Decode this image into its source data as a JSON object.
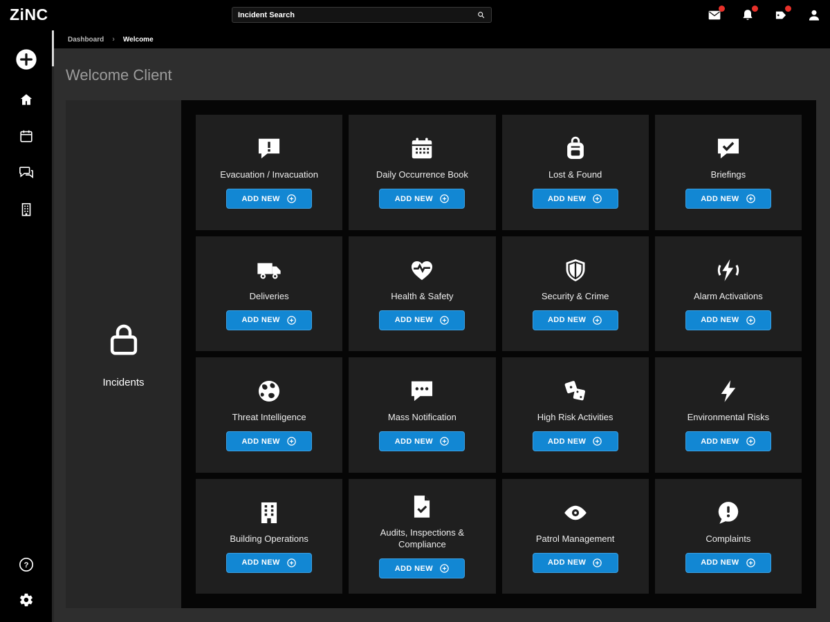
{
  "colors": {
    "accent_blue": "#1287d3",
    "badge_red": "#e8312a",
    "card_bg": "#1f1f1f",
    "panel_bg": "#060606",
    "main_bg": "#2e2e2e"
  },
  "topbar": {
    "logo": "ZiNC",
    "search": {
      "value": "Incident Search",
      "icon": "search-icon"
    },
    "actions": [
      {
        "name": "messages",
        "icon": "envelope-icon",
        "badge": true
      },
      {
        "name": "notifications",
        "icon": "bell-icon",
        "badge": true
      },
      {
        "name": "tickets",
        "icon": "ticket-icon",
        "badge": true
      },
      {
        "name": "profile",
        "icon": "user-icon",
        "badge": false
      }
    ]
  },
  "breadcrumb": {
    "items": [
      "Dashboard",
      "Welcome"
    ],
    "separator": "›"
  },
  "sidebar": {
    "top_items": [
      {
        "name": "add",
        "icon": "plus-circle-icon",
        "size": 32
      },
      {
        "name": "home",
        "icon": "home-icon",
        "size": 22
      },
      {
        "name": "calendar",
        "icon": "calendar-icon",
        "size": 22
      },
      {
        "name": "chat",
        "icon": "chat-icon",
        "size": 22
      },
      {
        "name": "building",
        "icon": "building-icon",
        "size": 22
      }
    ],
    "bottom_items": [
      {
        "name": "help",
        "icon": "help-icon",
        "size": 22
      },
      {
        "name": "settings",
        "icon": "gear-icon",
        "size": 22
      }
    ]
  },
  "page": {
    "title": "Welcome Client"
  },
  "incidents_panel": {
    "label": "Incidents",
    "icon": "lock-icon",
    "button_label": "ADD NEW",
    "cards": [
      {
        "label": "Evacuation / Invacuation",
        "icon": "speech-exclamation-icon"
      },
      {
        "label": "Daily Occurrence Book",
        "icon": "occurrence-calendar-icon"
      },
      {
        "label": "Lost & Found",
        "icon": "backpack-icon"
      },
      {
        "label": "Briefings",
        "icon": "speech-check-icon"
      },
      {
        "label": "Deliveries",
        "icon": "truck-icon"
      },
      {
        "label": "Health & Safety",
        "icon": "heart-pulse-icon"
      },
      {
        "label": "Security & Crime",
        "icon": "shield-icon"
      },
      {
        "label": "Alarm Activations",
        "icon": "alarm-bolt-icon"
      },
      {
        "label": "Threat Intelligence",
        "icon": "globe-icon"
      },
      {
        "label": "Mass Notification",
        "icon": "speech-dots-icon"
      },
      {
        "label": "High Risk Activities",
        "icon": "dice-icon"
      },
      {
        "label": "Environmental Risks",
        "icon": "bolt-icon"
      },
      {
        "label": "Building Operations",
        "icon": "building-large-icon"
      },
      {
        "label": "Audits, Inspections & Compliance",
        "icon": "document-check-icon"
      },
      {
        "label": "Patrol Management",
        "icon": "eye-icon"
      },
      {
        "label": "Complaints",
        "icon": "speech-round-exclamation-icon"
      }
    ]
  }
}
